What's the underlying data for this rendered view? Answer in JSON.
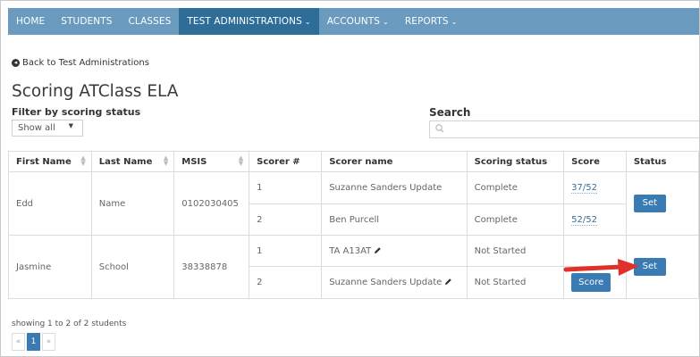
{
  "nav": {
    "items": [
      {
        "label": "HOME",
        "active": false,
        "dropdown": false
      },
      {
        "label": "STUDENTS",
        "active": false,
        "dropdown": false
      },
      {
        "label": "CLASSES",
        "active": false,
        "dropdown": false
      },
      {
        "label": "TEST ADMINISTRATIONS",
        "active": true,
        "dropdown": true
      },
      {
        "label": "ACCOUNTS",
        "active": false,
        "dropdown": true
      },
      {
        "label": "REPORTS",
        "active": false,
        "dropdown": true
      }
    ]
  },
  "back_link": "Back to Test Administrations",
  "page_title": "Scoring ATClass ELA",
  "filter": {
    "label": "Filter by scoring status",
    "selected": "Show all"
  },
  "search": {
    "label": "Search",
    "value": ""
  },
  "table": {
    "headers": [
      "First Name",
      "Last Name",
      "MSIS",
      "Scorer #",
      "Scorer name",
      "Scoring status",
      "Score",
      "Status"
    ],
    "students": [
      {
        "first_name": "Edd",
        "last_name": "Name",
        "msis": "0102030405",
        "status_button": "Set",
        "scorers": [
          {
            "number": "1",
            "name": "Suzanne Sanders Update",
            "editable": false,
            "scoring_status": "Complete",
            "score": "37/52"
          },
          {
            "number": "2",
            "name": "Ben Purcell",
            "editable": false,
            "scoring_status": "Complete",
            "score": "52/52"
          }
        ]
      },
      {
        "first_name": "Jasmine",
        "last_name": "School",
        "msis": "38338878",
        "status_button": "Set",
        "scorers": [
          {
            "number": "1",
            "name": "TA A13AT",
            "editable": true,
            "scoring_status": "Not Started",
            "score": ""
          },
          {
            "number": "2",
            "name": "Suzanne Sanders Update",
            "editable": true,
            "scoring_status": "Not Started",
            "score_button": "Score"
          }
        ]
      }
    ]
  },
  "info_text": "showing 1 to 2 of 2 students",
  "pagination": {
    "prev": "«",
    "current": "1",
    "next": "»"
  },
  "colors": {
    "nav_bg": "#6a9bbf",
    "nav_active": "#2f6d99",
    "button": "#3b7bb3",
    "annotation_arrow": "#e0302a"
  }
}
